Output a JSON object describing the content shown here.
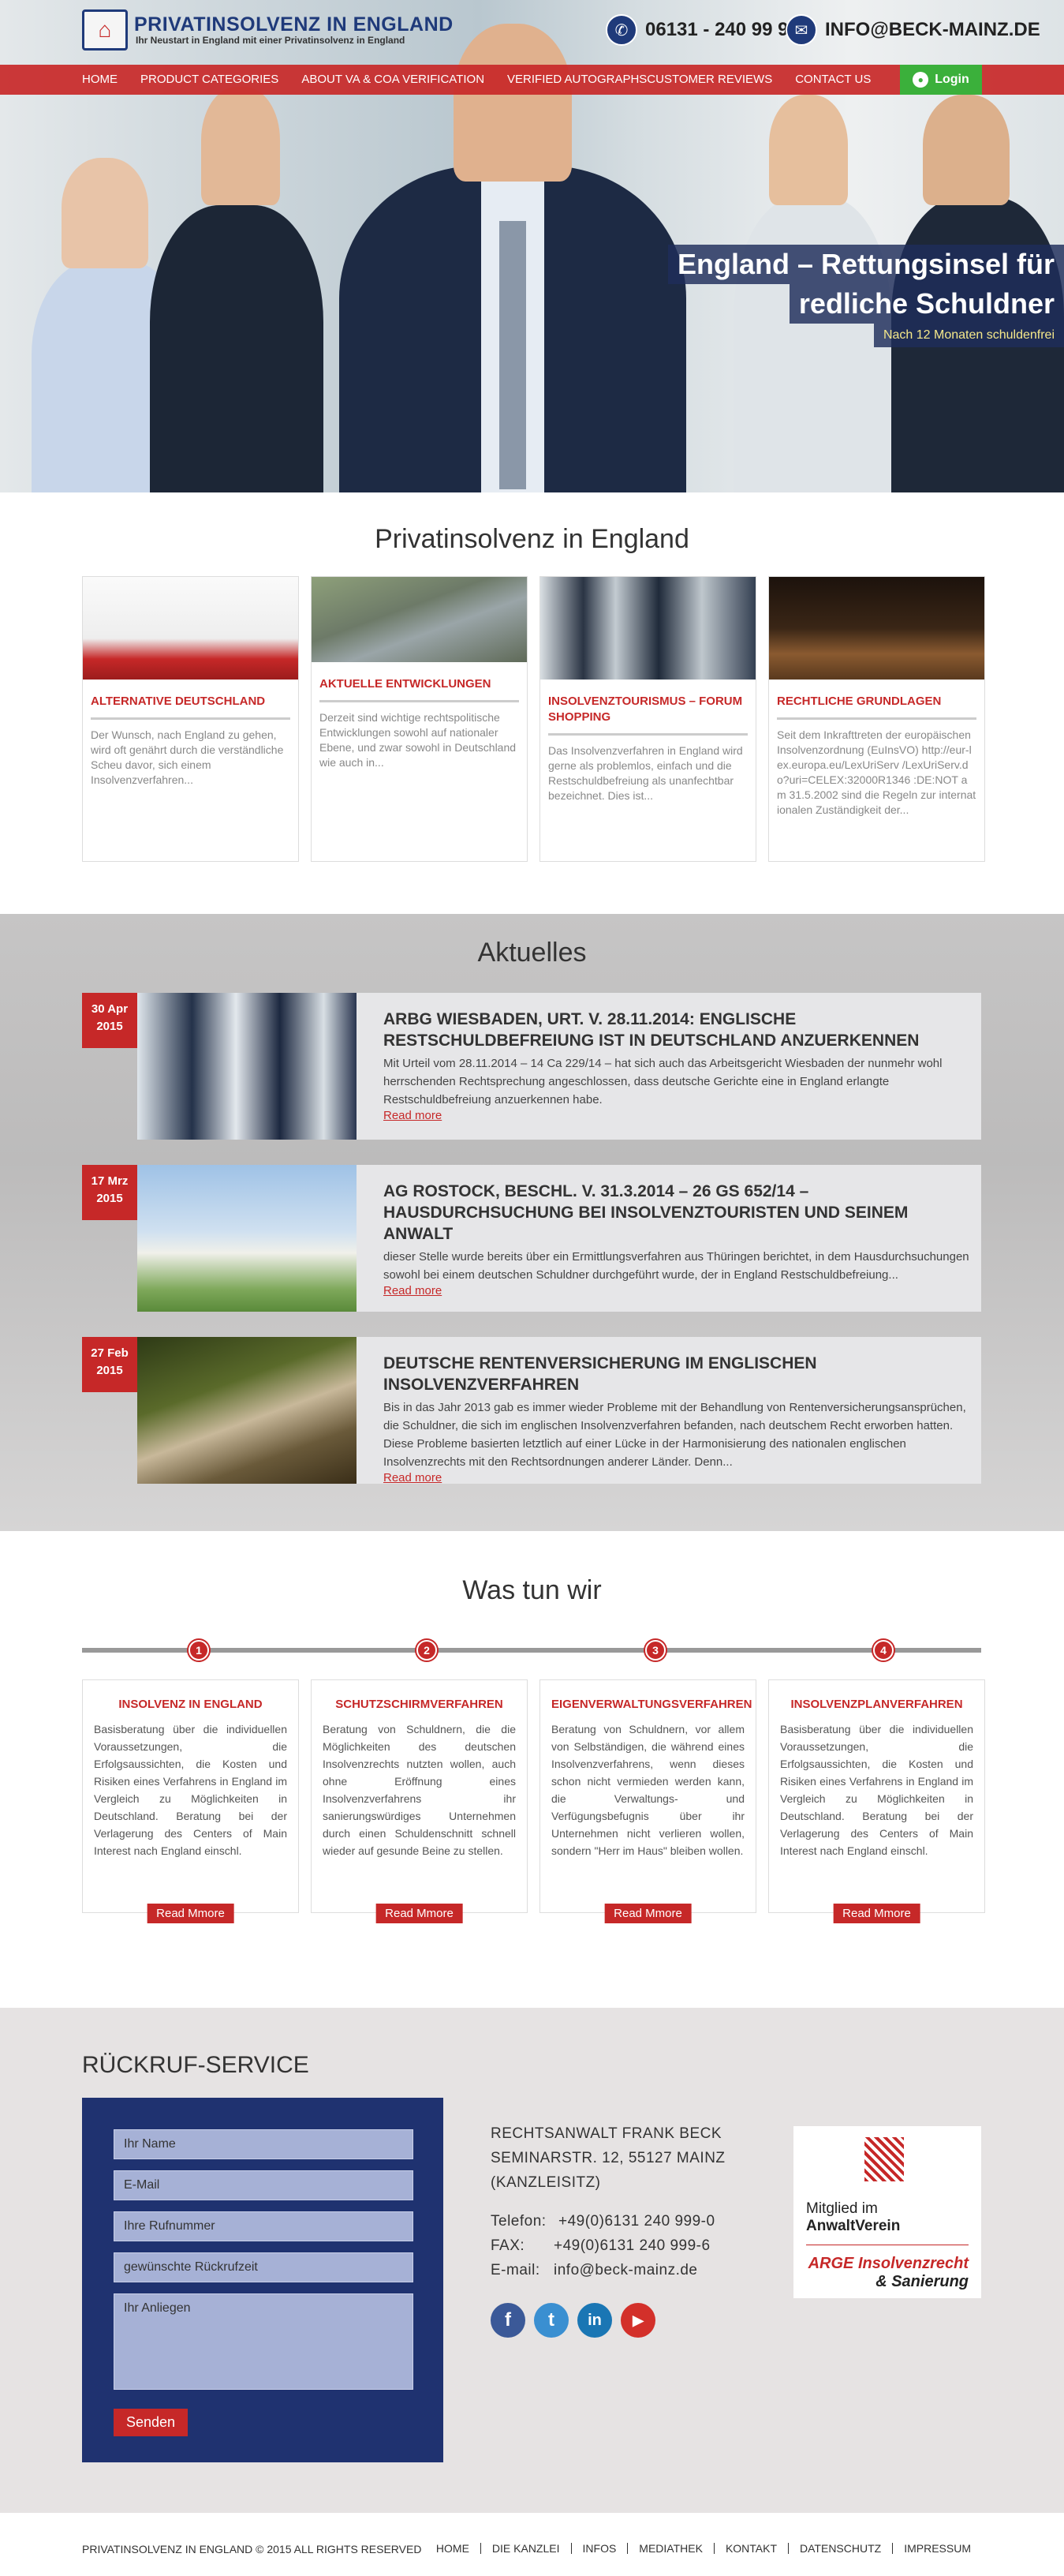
{
  "brand": {
    "title": "PRIVATINSOLVENZ IN ENGLAND",
    "subtitle": "Ihr Neustart in England mit einer Privatinsolvenz in England"
  },
  "contact": {
    "phone": "06131 - 240 99 90",
    "email": "INFO@BECK-MAINZ.DE"
  },
  "nav": [
    "HOME",
    "PRODUCT CATEGORIES",
    "ABOUT VA & COA VERIFICATION",
    "VERIFIED AUTOGRAPHS",
    "CUSTOMER REVIEWS",
    "CONTACT US"
  ],
  "login": "Login",
  "hero": {
    "line1": "England – Rettungsinsel für",
    "line2": "redliche Schuldner",
    "line3": "Nach 12 Monaten schuldenfrei"
  },
  "section1": {
    "title": "Privatinsolvenz in England",
    "cards": [
      {
        "title": "ALTERNATIVE DEUTSCHLAND",
        "text": "Der Wunsch, nach England zu gehen, wird oft genährt durch die verständliche Scheu davor, sich einem Insolvenzverfahren..."
      },
      {
        "title": "AKTUELLE ENTWICKLUNGEN",
        "text": "Derzeit sind wichtige rechtspolitische Entwicklungen sowohl auf nationaler Ebene, und zwar sowohl in Deutschland wie auch in..."
      },
      {
        "title": "INSOLVENZTOURISMUS – FORUM SHOPPING",
        "text": "Das Insolvenzverfahren in England wird gerne als problemlos, einfach und die Restschuldbefreiung als unanfechtbar bezeichnet. Dies ist..."
      },
      {
        "title": "RECHTLICHE GRUNDLAGEN",
        "text": "Seit dem Inkrafttreten der europäischen Insolvenzordnung (EuInsVO) http://eur-lex.europa.eu/LexUriServ /LexUriServ.do?uri=CELEX:32000R1346 :DE:NOT am 31.5.2002 sind die Regeln zur internationalen Zuständigkeit der..."
      }
    ]
  },
  "news": {
    "title": "Aktuelles",
    "items": [
      {
        "date1": "30 Apr",
        "date2": "2015",
        "title": "ARBG WIESBADEN, URT. V. 28.11.2014: ENGLISCHE RESTSCHULDBEFREIUNG IST IN DEUTSCHLAND ANZUERKENNEN",
        "text": "Mit Urteil vom 28.11.2014 – 14 Ca 229/14 – hat sich auch das Arbeitsgericht Wiesbaden der nunmehr wohl herrschenden Rechtsprechung angeschlossen, dass deutsche Gerichte eine in England erlangte Restschuldbefreiung anzuerkennen habe.",
        "more": "Read more"
      },
      {
        "date1": "17 Mrz",
        "date2": "2015",
        "title": "AG ROSTOCK, BESCHL. V. 31.3.2014 – 26 GS 652/14 – HAUSDURCHSUCHUNG BEI INSOLVENZTOURISTEN UND SEINEM ANWALT",
        "text": "dieser Stelle wurde bereits über ein Ermittlungsverfahren aus Thüringen berichtet, in dem Hausdurchsuchungen sowohl bei einem deutschen Schuldner durchgeführt wurde, der in England Restschuldbefreiung...",
        "more": "Read more"
      },
      {
        "date1": "27 Feb",
        "date2": "2015",
        "title": "DEUTSCHE RENTENVERSICHERUNG IM ENGLISCHEN INSOLVENZVERFAHREN",
        "text": "Bis in das Jahr 2013 gab es immer wieder Probleme mit der Behandlung von Rentenversicherungsansprüchen, die Schuldner, die sich im englischen Insolvenzverfahren befanden, nach deutschem Recht erworben hatten. Diese Probleme basierten letztlich auf einer Lücke in der Harmonisierung des nationalen englischen Insolvenzrechts mit den Rechtsordnungen anderer Länder. Denn...",
        "more": "Read more"
      }
    ]
  },
  "services": {
    "title": "Was tun wir",
    "steps": [
      "1",
      "2",
      "3",
      "4"
    ],
    "cards": [
      {
        "title": "INSOLVENZ IN ENGLAND",
        "text": "Basisberatung über die individuellen Voraussetzungen, die Erfolgsaussichten, die Kosten und Risiken eines Verfahrens in England im Vergleich zu Möglichkeiten in Deutschland. Beratung bei der Verlagerung des Centers of Main Interest nach England einschl.",
        "btn": "Read Mmore"
      },
      {
        "title": "SCHUTZSCHIRMVERFAHREN",
        "text": "Beratung von Schuldnern, die die Möglichkeiten des deutschen Insolvenzrechts nutzten wollen, auch ohne Eröffnung eines Insolvenzverfahrens ihr sanierungswürdiges Unternehmen durch einen Schuldenschnitt schnell wieder auf gesunde Beine zu stellen.",
        "btn": "Read Mmore"
      },
      {
        "title": "EIGENVERWALTUNGSVERFAHREN",
        "text": "Beratung von Schuldnern, vor allem von Selbständigen, die während eines Insolvenzverfahrens, wenn dieses schon nicht vermieden werden kann, die Verwaltungs- und Verfügungsbefugnis über ihr Unternehmen nicht verlieren wollen, sondern \"Herr im Haus\" bleiben wollen.",
        "btn": "Read Mmore"
      },
      {
        "title": "INSOLVENZPLANVERFAHREN",
        "text": "Basisberatung über die individuellen Voraussetzungen, die Erfolgsaussichten, die Kosten und Risiken eines Verfahrens in England im Vergleich zu Möglichkeiten in Deutschland. Beratung bei der Verlagerung des Centers of Main Interest nach England einschl.",
        "btn": "Read Mmore"
      }
    ]
  },
  "callback": {
    "title": "RÜCKRUF-SERVICE",
    "fields": {
      "name": "Ihr Name",
      "email": "E-Mail",
      "phone": "Ihre Rufnummer",
      "time": "gewünschte Rückrufzeit",
      "message": "Ihr Anliegen"
    },
    "submit": "Senden"
  },
  "address": {
    "l1": "RECHTSANWALT FRANK BECK",
    "l2": "SEMINARSTR. 12, 55127 MAINZ",
    "l3": "(KANZLEISITZ)",
    "tel_label": "Telefon:",
    "tel": "+49(0)6131 240 999-0",
    "fax_label": "FAX:",
    "fax": "+49(0)6131 240 999-6",
    "mail_label": "E-mail:",
    "mail": "info@beck-mainz.de"
  },
  "social": [
    "f",
    "t",
    "in",
    "▶"
  ],
  "badge": {
    "member": "Mitglied im",
    "anwalt": "AnwaltVerein",
    "arge1": "ARGE Insolvenzrecht",
    "arge2": "& Sanierung"
  },
  "footer": {
    "copy": "PRIVATINSOLVENZ IN ENGLAND © 2015 ALL RIGHTS RESERVED",
    "links": [
      "HOME",
      "DIE KANZLEI",
      "INFOS",
      "MEDIATHEK",
      "KONTAKT",
      "DATENSCHUTZ",
      "IMPRESSUM"
    ]
  },
  "colors": {
    "accent": "#c62828",
    "navy": "#1f3270",
    "green": "#3bb03b"
  }
}
